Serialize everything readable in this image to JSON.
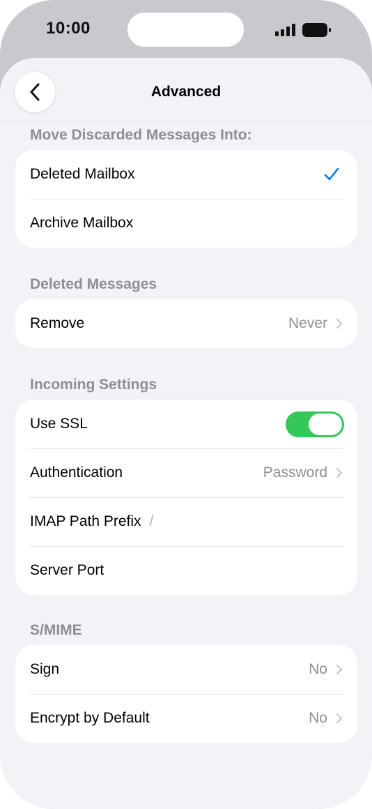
{
  "status_bar": {
    "time": "10:00"
  },
  "nav": {
    "title": "Advanced"
  },
  "sections": {
    "move_discarded": {
      "header": "Move Discarded Messages Into:",
      "deleted_mailbox": "Deleted Mailbox",
      "archive_mailbox": "Archive Mailbox",
      "selected": "Deleted Mailbox"
    },
    "deleted_messages": {
      "header": "Deleted Messages",
      "remove_label": "Remove",
      "remove_value": "Never"
    },
    "incoming": {
      "header": "Incoming Settings",
      "use_ssl_label": "Use SSL",
      "use_ssl_on": true,
      "authentication_label": "Authentication",
      "authentication_value": "Password",
      "imap_prefix_label": "IMAP Path Prefix",
      "imap_prefix_value": "/",
      "server_port_label": "Server Port"
    },
    "smime": {
      "header": "S/MIME",
      "sign_label": "Sign",
      "sign_value": "No",
      "encrypt_label": "Encrypt by Default",
      "encrypt_value": "No"
    }
  },
  "colors": {
    "accent": "#007aff",
    "toggle_on": "#34c759",
    "secondary_text": "#8e8e93",
    "background": "#f2f2f7"
  },
  "icons": [
    "back-chevron-icon",
    "checkmark-icon",
    "chevron-right-icon",
    "signal-icon",
    "battery-icon"
  ]
}
